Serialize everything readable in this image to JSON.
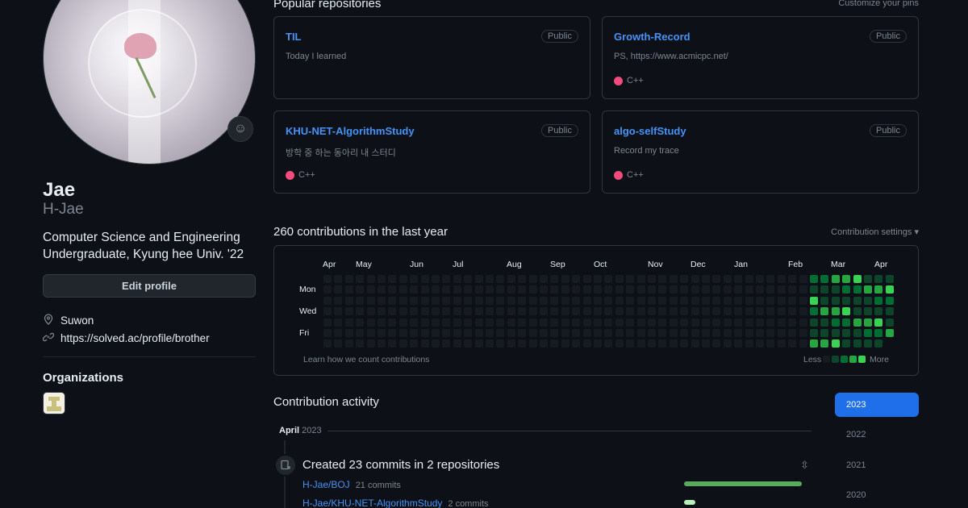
{
  "profile": {
    "name": "Jae",
    "login": "H-Jae",
    "bio_line1": "Computer Science and Engineering",
    "bio_line2": "Undergraduate, Kyung hee Univ. '22",
    "edit_label": "Edit profile",
    "location": "Suwon",
    "website": "https://solved.ac/profile/brother",
    "orgs_title": "Organizations",
    "icons": {
      "emoji": "smiley-icon",
      "location": "location-pin-icon",
      "link": "link-icon"
    }
  },
  "pinned": {
    "title": "Popular repositories",
    "customize": "Customize your pins",
    "items": [
      {
        "repo": "TIL",
        "badge": "Public",
        "desc": "Today I learned",
        "lang": ""
      },
      {
        "repo": "Growth-Record",
        "badge": "Public",
        "desc": "PS, https://www.acmicpc.net/",
        "lang": "C++"
      },
      {
        "repo": "KHU-NET-AlgorithmStudy",
        "badge": "Public",
        "desc": "방학 중 하는 동아리 내 스터디",
        "lang": "C++"
      },
      {
        "repo": "algo-selfStudy",
        "badge": "Public",
        "desc": "Record my trace",
        "lang": "C++"
      }
    ],
    "lang_color": "#f34b7d"
  },
  "contributions": {
    "title": "260 contributions in the last year",
    "settings": "Contribution settings ▾",
    "months": [
      "Apr",
      "May",
      "Jun",
      "Jul",
      "Aug",
      "Sep",
      "Oct",
      "Nov",
      "Dec",
      "Jan",
      "Feb",
      "Mar",
      "Apr"
    ],
    "days": [
      "Mon",
      "Wed",
      "Fri"
    ],
    "learn": "Learn how we count contributions",
    "less": "Less",
    "more": "More",
    "colors": [
      "#161b22",
      "#0e4429",
      "#006d32",
      "#26a641",
      "#39d353"
    ]
  },
  "activity": {
    "title": "Contribution activity",
    "years": [
      "2023",
      "2022",
      "2021",
      "2020"
    ],
    "active_year": "2023",
    "month": "April",
    "month_year": "2023",
    "summary": "Created 23 commits in 2 repositories",
    "rows": [
      {
        "repo": "H-Jae/BOJ",
        "commits": "21 commits",
        "count": 21
      },
      {
        "repo": "H-Jae/KHU-NET-AlgorithmStudy",
        "commits": "2 commits",
        "count": 2
      }
    ]
  }
}
